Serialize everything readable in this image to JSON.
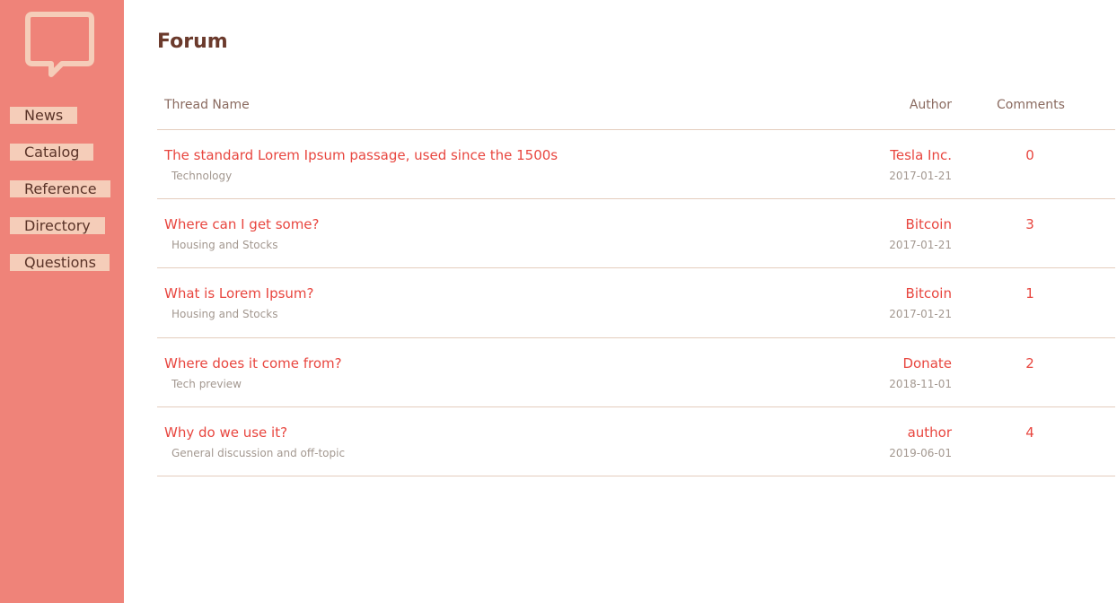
{
  "sidebar": {
    "logo_icon": "speech-bubble-icon",
    "colors": {
      "background": "#ef8379",
      "nav_background": "#f5cdb9",
      "nav_text": "#5a3328",
      "logo": "#f5cdb9"
    },
    "nav": [
      "News",
      "Catalog",
      "Reference",
      "Directory",
      "Questions"
    ]
  },
  "page": {
    "title": "Forum"
  },
  "table": {
    "headers": {
      "thread": "Thread Name",
      "author": "Author",
      "comments": "Comments"
    },
    "accent_color": "#e8463f",
    "rows": [
      {
        "title": "The standard Lorem Ipsum passage, used since the 1500s",
        "category": "Technology",
        "author": "Tesla Inc.",
        "date": "2017-01-21",
        "comments": "0"
      },
      {
        "title": "Where can I get some?",
        "category": "Housing and Stocks",
        "author": "Bitcoin",
        "date": "2017-01-21",
        "comments": "3"
      },
      {
        "title": "What is Lorem Ipsum?",
        "category": "Housing and Stocks",
        "author": "Bitcoin",
        "date": "2017-01-21",
        "comments": "1"
      },
      {
        "title": "Where does it come from?",
        "category": "Tech preview",
        "author": "Donate",
        "date": "2018-11-01",
        "comments": "2"
      },
      {
        "title": "Why do we use it?",
        "category": "General discussion and off-topic",
        "author": "author",
        "date": "2019-06-01",
        "comments": "4"
      }
    ]
  }
}
